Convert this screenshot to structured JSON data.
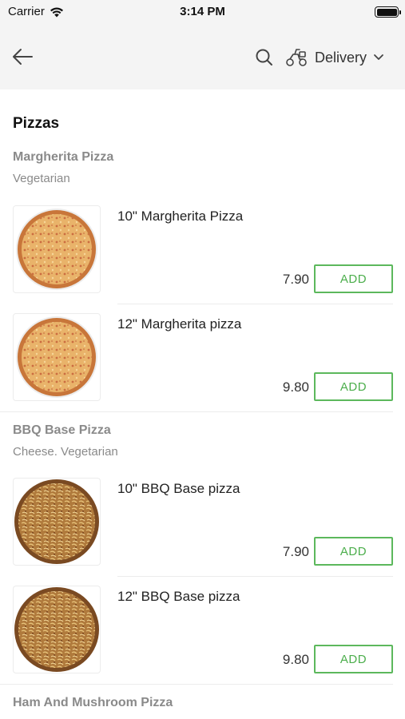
{
  "status_bar": {
    "carrier": "Carrier",
    "time": "3:14 PM"
  },
  "nav": {
    "delivery_label": "Delivery"
  },
  "section": {
    "title": "Pizzas"
  },
  "groups": [
    {
      "title": "Margherita Pizza",
      "subtitle": "Vegetarian",
      "items": [
        {
          "name": "10\" Margherita Pizza",
          "price": "7.90",
          "add_label": "ADD"
        },
        {
          "name": "12\" Margherita pizza",
          "price": "9.80",
          "add_label": "ADD"
        }
      ]
    },
    {
      "title": "BBQ Base Pizza",
      "subtitle": "Cheese. Vegetarian",
      "items": [
        {
          "name": "10\" BBQ Base pizza",
          "price": "7.90",
          "add_label": "ADD"
        },
        {
          "name": "12\" BBQ Base pizza",
          "price": "9.80",
          "add_label": "ADD"
        }
      ]
    },
    {
      "title": "Ham And Mushroom Pizza",
      "subtitle": "",
      "items": []
    }
  ],
  "colors": {
    "accent": "#5cb85c",
    "header_bg": "#f4f4f4",
    "muted_text": "#8a8a8a"
  },
  "icons": {
    "back": "arrow-left-icon",
    "search": "search-icon",
    "delivery": "scooter-icon",
    "dropdown": "chevron-down-icon",
    "wifi": "wifi-icon",
    "battery": "battery-icon",
    "margherita_thumb": "margherita-pizza-image",
    "bbq_thumb": "bbq-pizza-image"
  }
}
